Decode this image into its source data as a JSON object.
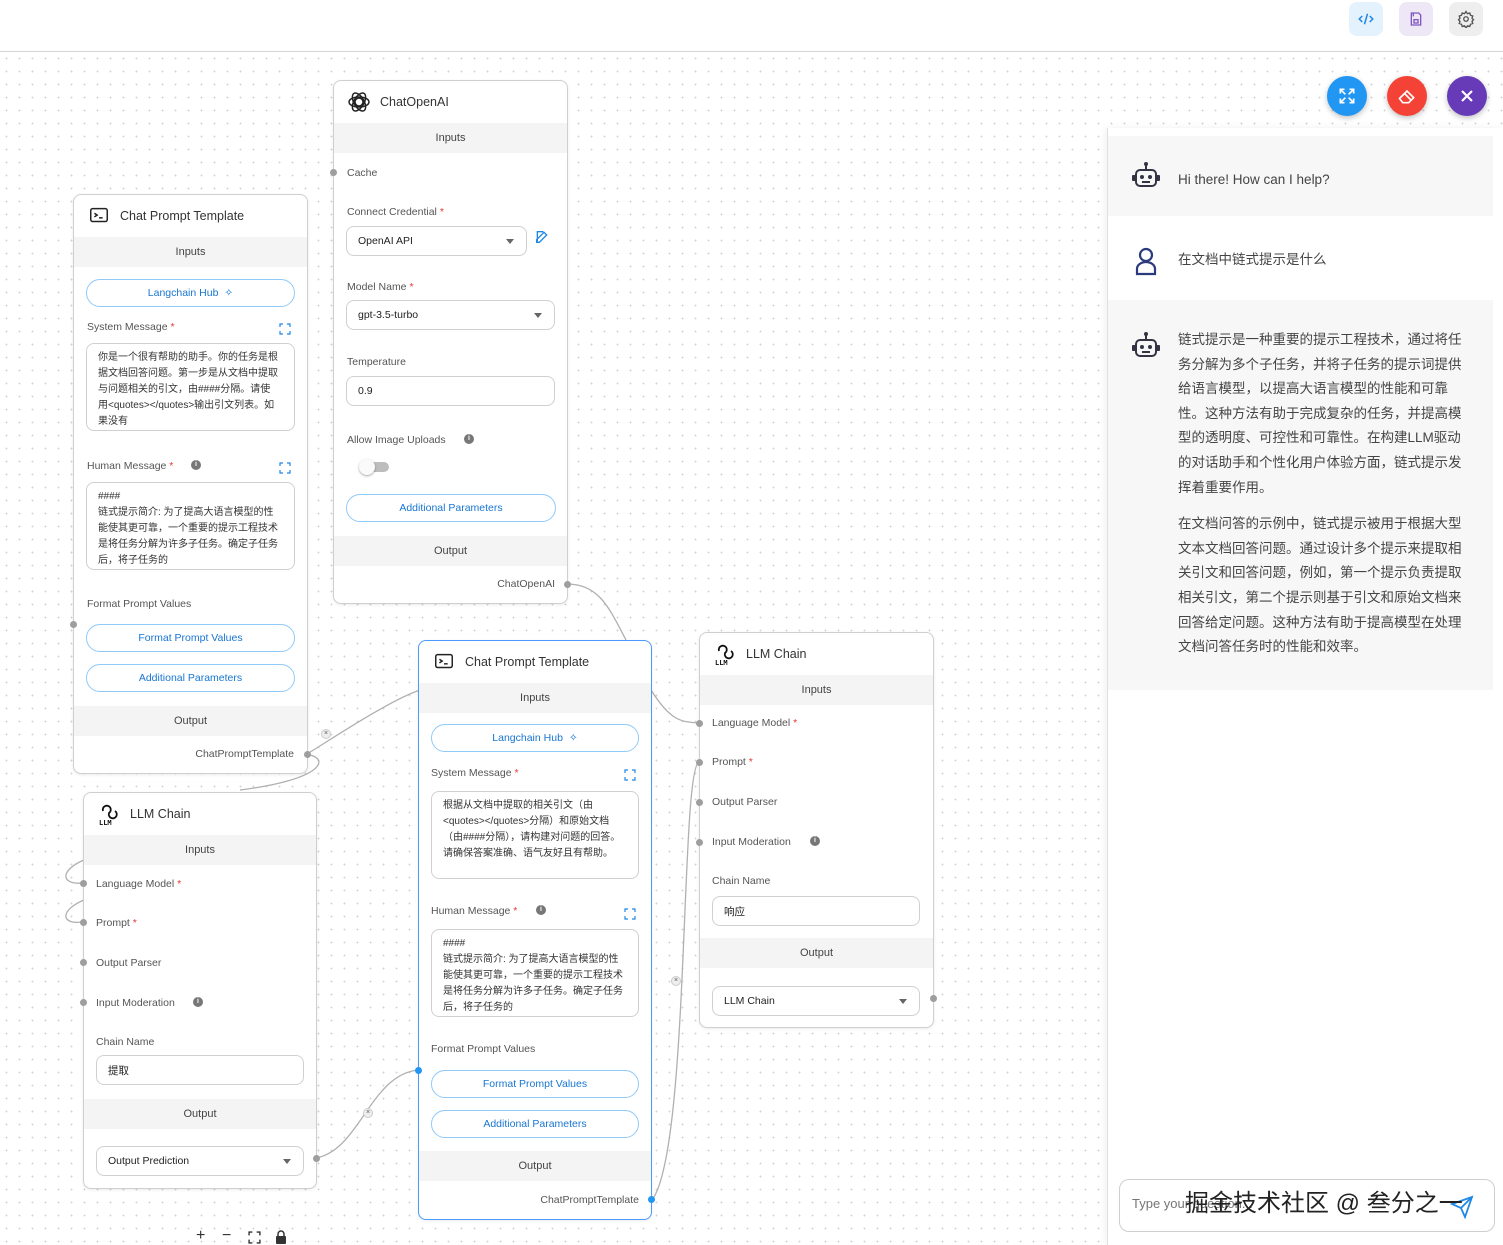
{
  "toolbar": {
    "code_icon": "code-icon",
    "save_icon": "save-icon",
    "settings_icon": "gear-icon"
  },
  "colors": {
    "expand_fab": "#2196f3",
    "clear_fab": "#f44336",
    "close_fab": "#673ab7",
    "accent": "#1976d2",
    "required": "#e53935"
  },
  "chatopenai": {
    "title": "ChatOpenAI",
    "inputs_label": "Inputs",
    "cache_label": "Cache",
    "credential_label": "Connect Credential",
    "credential_value": "OpenAI API",
    "model_label": "Model Name",
    "model_value": "gpt-3.5-turbo",
    "temperature_label": "Temperature",
    "temperature_value": "0.9",
    "image_uploads_label": "Allow Image Uploads",
    "additional_params": "Additional Parameters",
    "output_label": "Output",
    "output_name": "ChatOpenAI"
  },
  "prompt1": {
    "title": "Chat Prompt Template",
    "inputs_label": "Inputs",
    "hub_label": "Langchain Hub",
    "system_label": "System Message",
    "system_text": "你是一个很有帮助的助手。你的任务是根据文档回答问题。第一步是从文档中提取与问题相关的引文，由####分隔。请使用<quotes></quotes>输出引文列表。如果没有",
    "human_label": "Human Message",
    "human_text": "####\n链式提示简介: 为了提高大语言模型的性能使其更可靠，一个重要的提示工程技术是将任务分解为许多子任务。确定子任务后，将子任务的",
    "format_label": "Format Prompt Values",
    "format_button": "Format Prompt Values",
    "additional_params": "Additional Parameters",
    "output_label": "Output",
    "output_name": "ChatPromptTemplate"
  },
  "prompt2": {
    "title": "Chat Prompt Template",
    "inputs_label": "Inputs",
    "hub_label": "Langchain Hub",
    "system_label": "System Message",
    "system_text": "根据从文档中提取的相关引文（由<quotes></quotes>分隔）和原始文档（由####分隔），请构建对问题的回答。请确保答案准确、语气友好且有帮助。",
    "human_label": "Human Message",
    "human_text": "####\n链式提示简介: 为了提高大语言模型的性能使其更可靠，一个重要的提示工程技术是将任务分解为许多子任务。确定子任务后，将子任务的",
    "format_label": "Format Prompt Values",
    "format_button": "Format Prompt Values",
    "additional_params": "Additional Parameters",
    "output_label": "Output",
    "output_name": "ChatPromptTemplate"
  },
  "llm1": {
    "title": "LLM Chain",
    "inputs_label": "Inputs",
    "language_model_label": "Language Model",
    "prompt_label": "Prompt",
    "output_parser_label": "Output Parser",
    "input_moderation_label": "Input Moderation",
    "chain_name_label": "Chain Name",
    "chain_name_value": "提取",
    "output_label": "Output",
    "output_select": "Output Prediction"
  },
  "llm2": {
    "title": "LLM Chain",
    "inputs_label": "Inputs",
    "language_model_label": "Language Model",
    "prompt_label": "Prompt",
    "output_parser_label": "Output Parser",
    "input_moderation_label": "Input Moderation",
    "chain_name_label": "Chain Name",
    "chain_name_value": "响应",
    "output_label": "Output",
    "output_select": "LLM Chain"
  },
  "chat": {
    "greeting": "Hi there! How can I help?",
    "user_message": "在文档中链式提示是什么",
    "answer_p1": "链式提示是一种重要的提示工程技术，通过将任务分解为多个子任务，并将子任务的提示词提供给语言模型，以提高大语言模型的性能和可靠性。这种方法有助于完成复杂的任务，并提高模型的透明度、可控性和可靠性。在构建LLM驱动的对话助手和个性化用户体验方面，链式提示发挥着重要作用。",
    "answer_p2": "在文档问答的示例中，链式提示被用于根据大型文本文档回答问题。通过设计多个提示来提取相关引文和回答问题，例如，第一个提示负责提取相关引文，第二个提示则基于引文和原始文档来回答给定问题。这种方法有助于提高模型在处理文档问答任务时的性能和效率。",
    "input_placeholder": "Type your question...",
    "watermark": "掘金技术社区 @ 叁分之一"
  },
  "canvas_controls": {
    "zoom_in": "+",
    "zoom_out": "−"
  }
}
